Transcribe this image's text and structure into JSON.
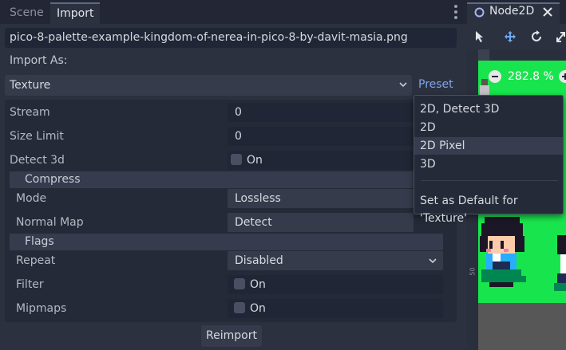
{
  "left_panel": {
    "tabs": [
      {
        "label": "Scene",
        "active": false
      },
      {
        "label": "Import",
        "active": true
      }
    ],
    "file_name": "pico-8-palette-example-kingdom-of-nerea-in-pico-8-by-davit-masia.png",
    "import_as_label": "Import As:",
    "import_as_value": "Texture",
    "preset_label": "Preset",
    "properties": {
      "stream": {
        "label": "Stream",
        "value": "0"
      },
      "size_limit": {
        "label": "Size Limit",
        "value": "0"
      },
      "detect_3d": {
        "label": "Detect 3d",
        "value": "On",
        "checked": false
      }
    },
    "compress": {
      "title": "Compress",
      "mode": {
        "label": "Mode",
        "value": "Lossless"
      },
      "normal_map": {
        "label": "Normal Map",
        "value": "Detect"
      }
    },
    "flags": {
      "title": "Flags",
      "repeat": {
        "label": "Repeat",
        "value": "Disabled"
      },
      "filter": {
        "label": "Filter",
        "value": "On",
        "checked": false
      },
      "mipmaps": {
        "label": "Mipmaps",
        "value": "On",
        "checked": false
      }
    },
    "reimport_label": "Reimport"
  },
  "preset_menu": {
    "items": [
      {
        "label": "2D, Detect 3D",
        "hovered": false
      },
      {
        "label": "2D",
        "hovered": false
      },
      {
        "label": "2D Pixel",
        "hovered": true
      },
      {
        "label": "3D",
        "hovered": false
      }
    ],
    "set_default_label": "Set as Default for 'Texture'"
  },
  "right_panel": {
    "tab_label": "Node2D",
    "zoom_label": "282.8 %",
    "ruler_mark": "50"
  },
  "colors": {
    "accent": "#7fa6e8",
    "canvas_background": "#18e54d",
    "panel": "#2c3140"
  }
}
